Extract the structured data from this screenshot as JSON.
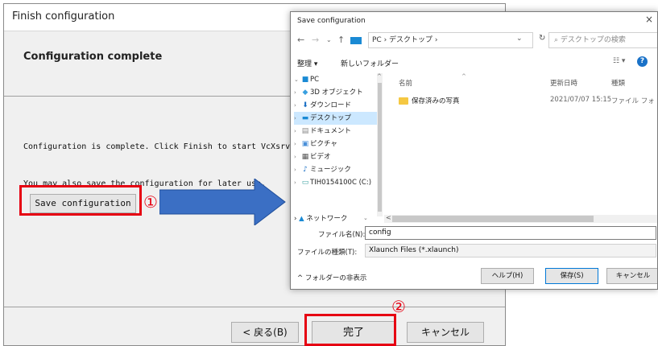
{
  "wizard": {
    "title": "Finish configuration",
    "heading": "Configuration complete",
    "complete_text": "Configuration is complete. Click Finish to start VcXsrv.",
    "also_save_text": "You may also save the configuration for later use.",
    "save_config_label": "Save configuration",
    "back_label": "< 戻る(B)",
    "finish_label": "完了",
    "cancel_label": "キャンセル"
  },
  "annotations": {
    "step1": "①",
    "step2": "②",
    "highlight_color": "#e60012",
    "arrow_color": "#3b6fc4"
  },
  "save_dialog": {
    "title": "Save configuration",
    "close": "×",
    "address": "PC › デスクトップ ›",
    "search_placeholder": "デスクトップの検索",
    "organize_label": "整理 ▾",
    "new_folder_label": "新しいフォルダー",
    "nav_tree": [
      {
        "label": "PC",
        "chev": "⌄",
        "icon": "pc-icon"
      },
      {
        "label": "3D オブジェクト",
        "chev": "›",
        "icon": "3d-objects-icon"
      },
      {
        "label": "ダウンロード",
        "chev": "›",
        "icon": "download-icon"
      },
      {
        "label": "デスクトップ",
        "chev": "›",
        "icon": "desktop-icon",
        "selected": true
      },
      {
        "label": "ドキュメント",
        "chev": "›",
        "icon": "document-icon"
      },
      {
        "label": "ピクチャ",
        "chev": "›",
        "icon": "pictures-icon"
      },
      {
        "label": "ビデオ",
        "chev": "›",
        "icon": "video-icon"
      },
      {
        "label": "ミュージック",
        "chev": "›",
        "icon": "music-icon"
      },
      {
        "label": "TIH0154100C (C:)",
        "chev": "›",
        "icon": "drive-icon"
      }
    ],
    "network_label": "ネットワーク",
    "columns": {
      "name": "名前",
      "date": "更新日時",
      "type": "種類"
    },
    "files": [
      {
        "name": "保存済みの写真",
        "date": "2021/07/07 15:15",
        "type": "ファイル フォ"
      }
    ],
    "filename_label": "ファイル名(N):",
    "filename_value": "config",
    "filetype_label": "ファイルの種類(T):",
    "filetype_value": "Xlaunch Files (*.xlaunch)",
    "hide_folders_label": "^ フォルダーの非表示",
    "help_label": "ヘルプ(H)",
    "save_label": "保存(S)",
    "cancel_label": "キャンセル"
  }
}
